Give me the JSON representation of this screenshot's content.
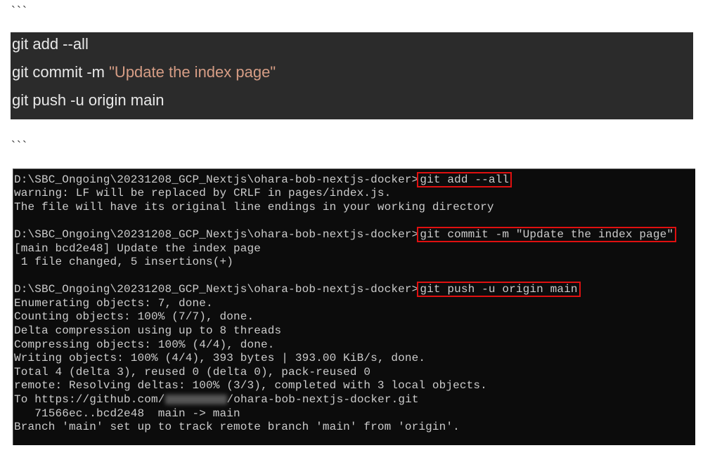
{
  "fence_open": "```",
  "fence_close": "```",
  "code_block": {
    "line1": "git add --all",
    "line2_cmd": "git commit -m ",
    "line2_str": "\"Update the index page\"",
    "line3": "git push -u origin main"
  },
  "terminal": {
    "prompt": "D:\\SBC_Ongoing\\20231208_GCP_Nextjs\\ohara-bob-nextjs-docker>",
    "cmd1": "git add --all",
    "out1": [
      "warning: LF will be replaced by CRLF in pages/index.js.",
      "The file will have its original line endings in your working directory"
    ],
    "cmd2": "git commit -m \"Update the index page\"",
    "out2": [
      "[main bcd2e48] Update the index page",
      " 1 file changed, 5 insertions(+)"
    ],
    "cmd3": "git push -u origin main",
    "out3": [
      "Enumerating objects: 7, done.",
      "Counting objects: 100% (7/7), done.",
      "Delta compression using up to 8 threads",
      "Compressing objects: 100% (4/4), done.",
      "Writing objects: 100% (4/4), 393 bytes | 393.00 KiB/s, done.",
      "Total 4 (delta 3), reused 0 (delta 0), pack-reused 0",
      "remote: Resolving deltas: 100% (3/3), completed with 3 local objects."
    ],
    "url_prefix": "To https://github.com/",
    "url_suffix": "/ohara-bob-nextjs-docker.git",
    "out4": [
      "   71566ec..bcd2e48  main -> main",
      "Branch 'main' set up to track remote branch 'main' from 'origin'."
    ]
  },
  "colors": {
    "highlight_box": "#e01010",
    "string": "#d69d85"
  }
}
